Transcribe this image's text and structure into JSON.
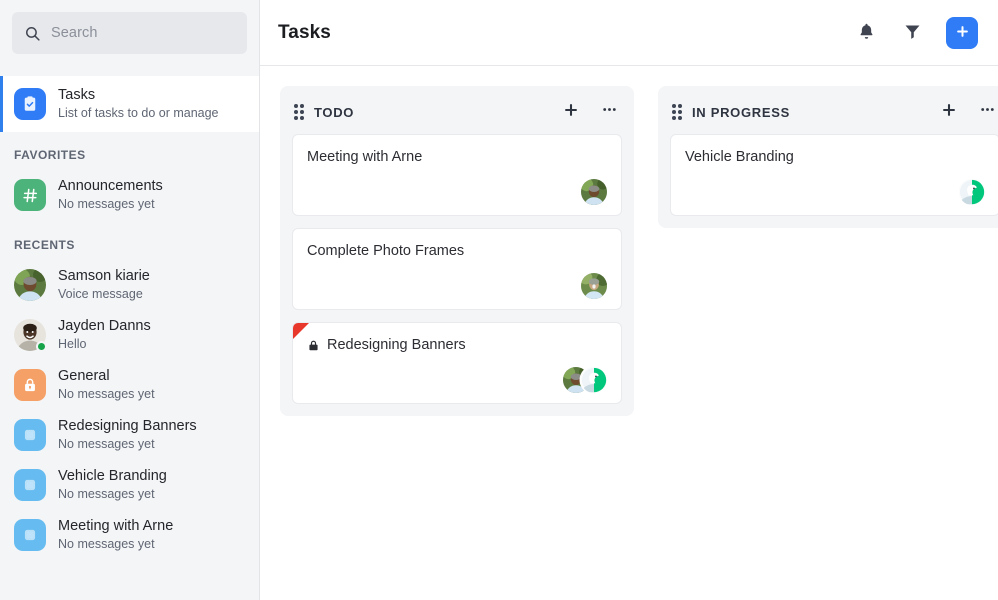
{
  "sidebar": {
    "search": {
      "placeholder": "Search",
      "value": "",
      "icon": "search-icon"
    },
    "selected_item": {
      "title": "Tasks",
      "subtitle": "List of tasks to do or manage",
      "icon": "clipboard-check-icon",
      "icon_color": "#2f7cf6",
      "accent_color": "#2f80ed"
    },
    "sections": [
      {
        "label": "FAVORITES",
        "items": [
          {
            "name": "Announcements",
            "subtitle": "No messages yet",
            "icon": "hash-icon",
            "avatar_type": "icon",
            "color": "#4cb37a",
            "presence": ""
          }
        ]
      },
      {
        "label": "RECENTS",
        "items": [
          {
            "name": "Samson kiarie",
            "subtitle": "Voice message",
            "icon": "person-photo-icon",
            "avatar_type": "photo-a",
            "color": "#7a9a5e",
            "presence": ""
          },
          {
            "name": "Jayden Danns",
            "subtitle": "Hello",
            "icon": "person-photo-icon",
            "avatar_type": "photo-b",
            "color": "#6b5a4a",
            "presence": "online"
          },
          {
            "name": "General",
            "subtitle": "No messages yet",
            "icon": "lock-icon",
            "avatar_type": "icon",
            "color": "#f5a066",
            "presence": ""
          },
          {
            "name": "Redesigning Banners",
            "subtitle": "No messages yet",
            "icon": "board-icon",
            "avatar_type": "icon",
            "color": "#66bcf0",
            "presence": ""
          },
          {
            "name": "Vehicle Branding",
            "subtitle": "No messages yet",
            "icon": "board-icon",
            "avatar_type": "icon",
            "color": "#66bcf0",
            "presence": ""
          },
          {
            "name": "Meeting with Arne",
            "subtitle": "No messages yet",
            "icon": "board-icon",
            "avatar_type": "icon",
            "color": "#66bcf0",
            "presence": ""
          }
        ]
      }
    ]
  },
  "topbar": {
    "title": "Tasks",
    "notifications_icon": "bell-icon",
    "filter_icon": "funnel-filter-icon",
    "add_icon": "plus-icon",
    "add_button_color": "#2f7cf6"
  },
  "board": {
    "columns": [
      {
        "title": "TODO",
        "handle_icon": "drag-handle-icon",
        "add_icon": "plus-icon",
        "more_icon": "more-horizontal-icon",
        "cards": [
          {
            "title": "Meeting with Arne",
            "locked": false,
            "flag": false,
            "members": [
              "photo-a"
            ]
          },
          {
            "title": "Complete Photo Frames",
            "locked": false,
            "flag": false,
            "members": [
              "photo-c"
            ]
          },
          {
            "title": "Redesigning Banners",
            "locked": true,
            "lock_icon": "lock-icon",
            "flag": true,
            "flag_color": "#e8372b",
            "members": [
              "photo-a",
              "photo-green"
            ]
          }
        ]
      },
      {
        "title": "IN PROGRESS",
        "handle_icon": "drag-handle-icon",
        "add_icon": "plus-icon",
        "more_icon": "more-horizontal-icon",
        "cards": [
          {
            "title": "Vehicle Branding",
            "locked": false,
            "flag": false,
            "members": [
              "photo-green"
            ]
          }
        ]
      }
    ]
  }
}
